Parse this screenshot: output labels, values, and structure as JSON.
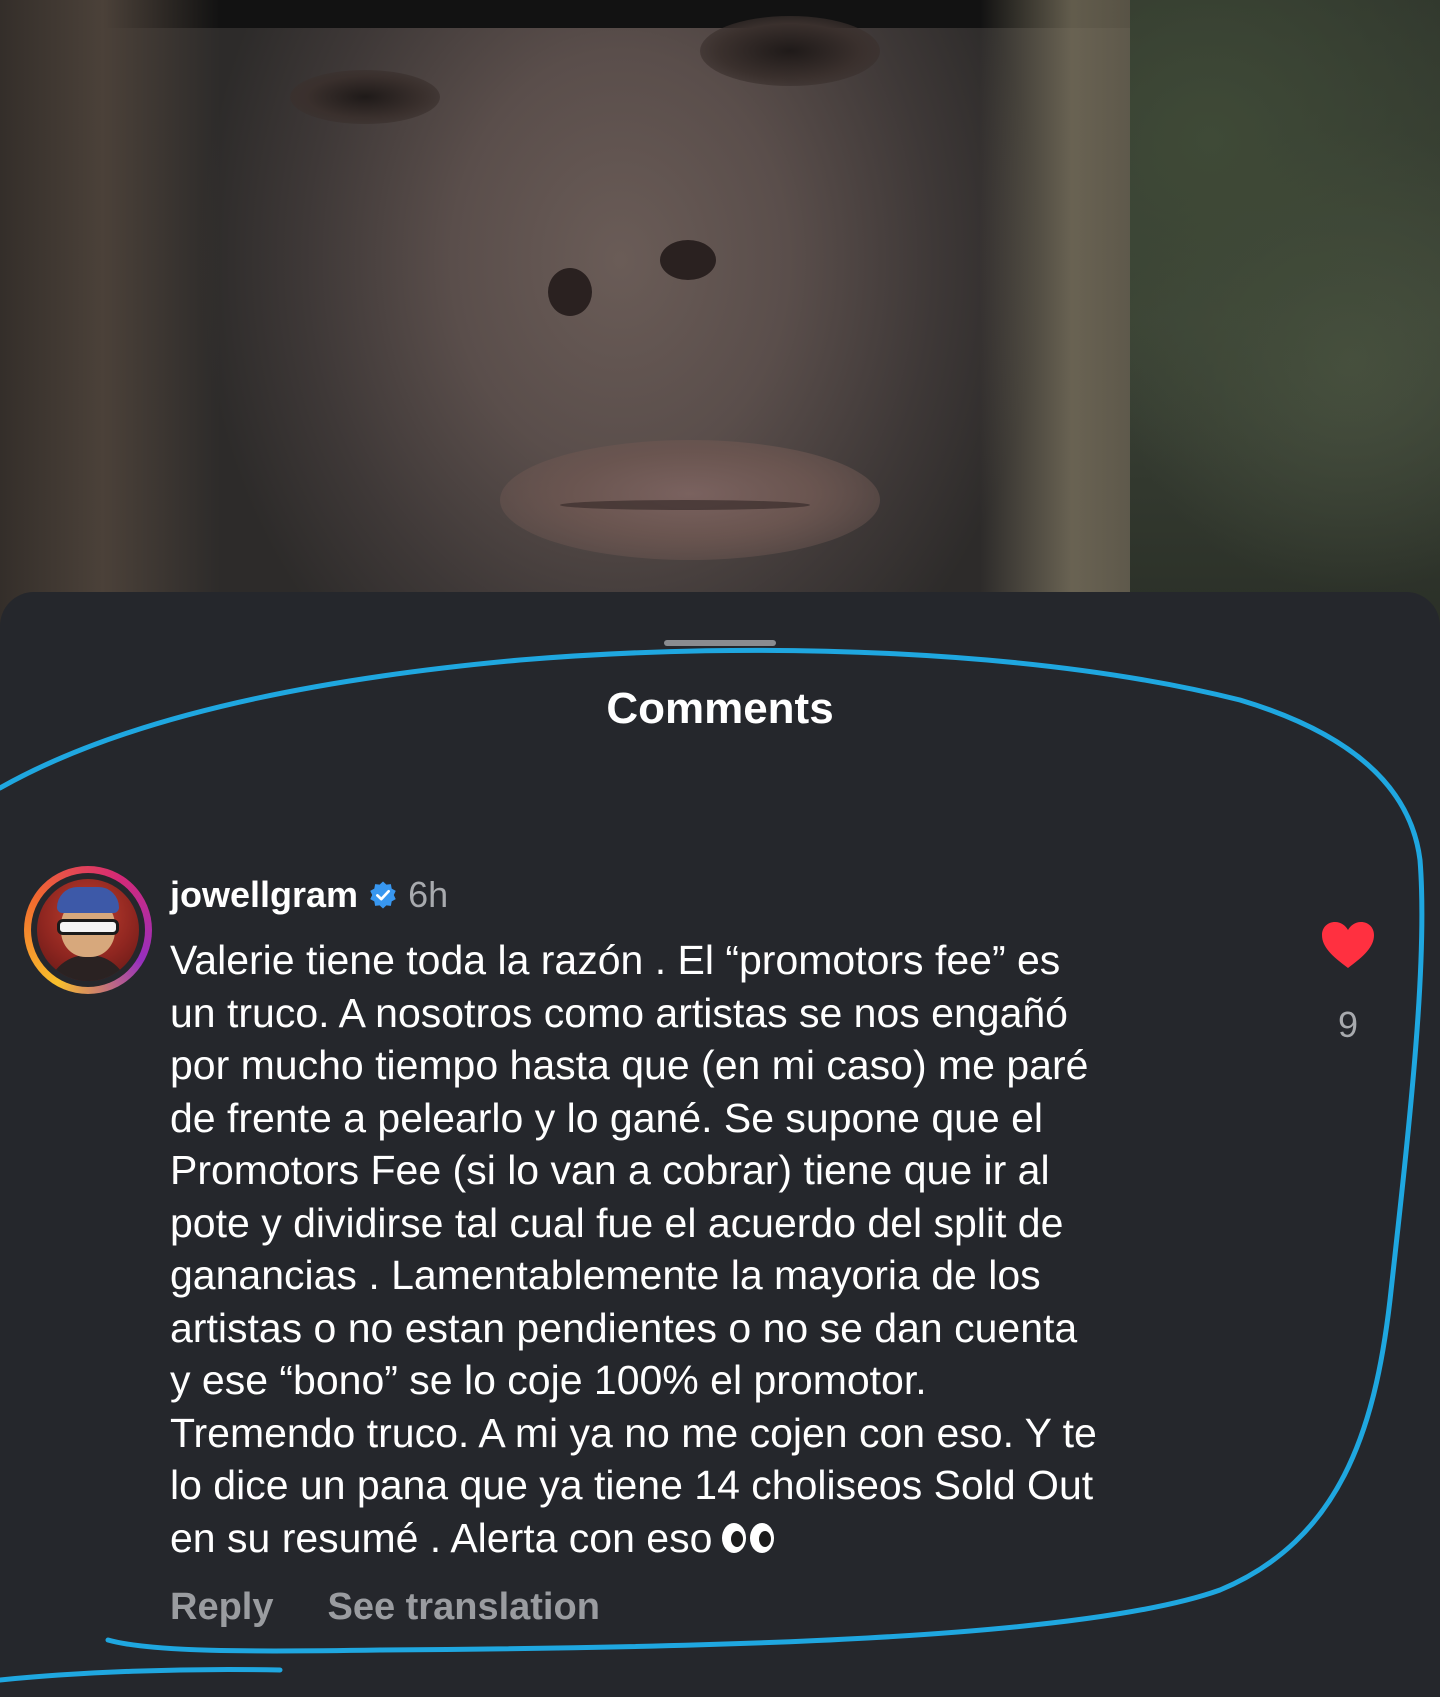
{
  "sheet": {
    "title": "Comments"
  },
  "comment": {
    "username": "jowellgram",
    "verified": true,
    "time": "6h",
    "text_lines": [
      "Valerie tiene toda la razón . El “promotors fee” es",
      "un truco. A nosotros como artistas se nos engañó",
      "por mucho tiempo hasta que (en mi caso) me paré",
      "de frente a pelearlo y lo gané. Se supone que el",
      "Promotors Fee (si lo van a cobrar) tiene que ir al",
      "pote y dividirse tal cual fue el acuerdo del split de",
      "ganancias . Lamentablemente la mayoria de los",
      "artistas o no estan pendientes o no se dan cuenta",
      "y ese “bono” se lo coje 100% el promotor.",
      "Tremendo truco. A mi ya no me cojen con eso. Y te",
      "lo dice un pana que ya tiene 14 choliseos Sold Out",
      "en su resumé . Alerta con eso"
    ],
    "like_count": "9",
    "reply_label": "Reply",
    "translate_label": "See translation"
  },
  "colors": {
    "sheet_background": "#25272c",
    "heart": "#ff3040",
    "verified_badge": "#3897f0",
    "annotation_stroke": "#1fa7e0"
  },
  "icons": {
    "verified": "verified-badge-icon",
    "like": "heart-icon",
    "emoji": "eyes-icon"
  }
}
